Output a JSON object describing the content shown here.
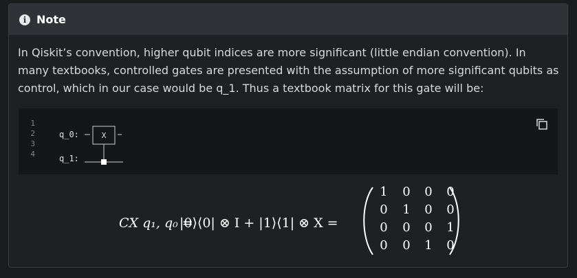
{
  "note": {
    "title": "Note",
    "icon": "info-icon",
    "paragraph": "In Qiskit’s convention, higher qubit indices are more significant (little endian convention). In many textbooks, controlled gates are presented with the assumption of more significant qubits as control, which in our case would be q_1. Thus a textbook matrix for this gate will be:"
  },
  "code": {
    "line_numbers": [
      "1",
      "2",
      "3",
      "4"
    ],
    "q0_label": "q_0:",
    "q1_label": "q_1:",
    "gate_label": "X",
    "copy_icon": "copy-icon"
  },
  "equation": {
    "lhs": "CX q₁, q₀ =",
    "middle": "|0⟩⟨0| ⊗ I + |1⟩⟨1| ⊗ X =",
    "matrix": [
      [
        "1",
        "0",
        "0",
        "0"
      ],
      [
        "0",
        "1",
        "0",
        "0"
      ],
      [
        "0",
        "0",
        "0",
        "1"
      ],
      [
        "0",
        "0",
        "1",
        "0"
      ]
    ]
  }
}
